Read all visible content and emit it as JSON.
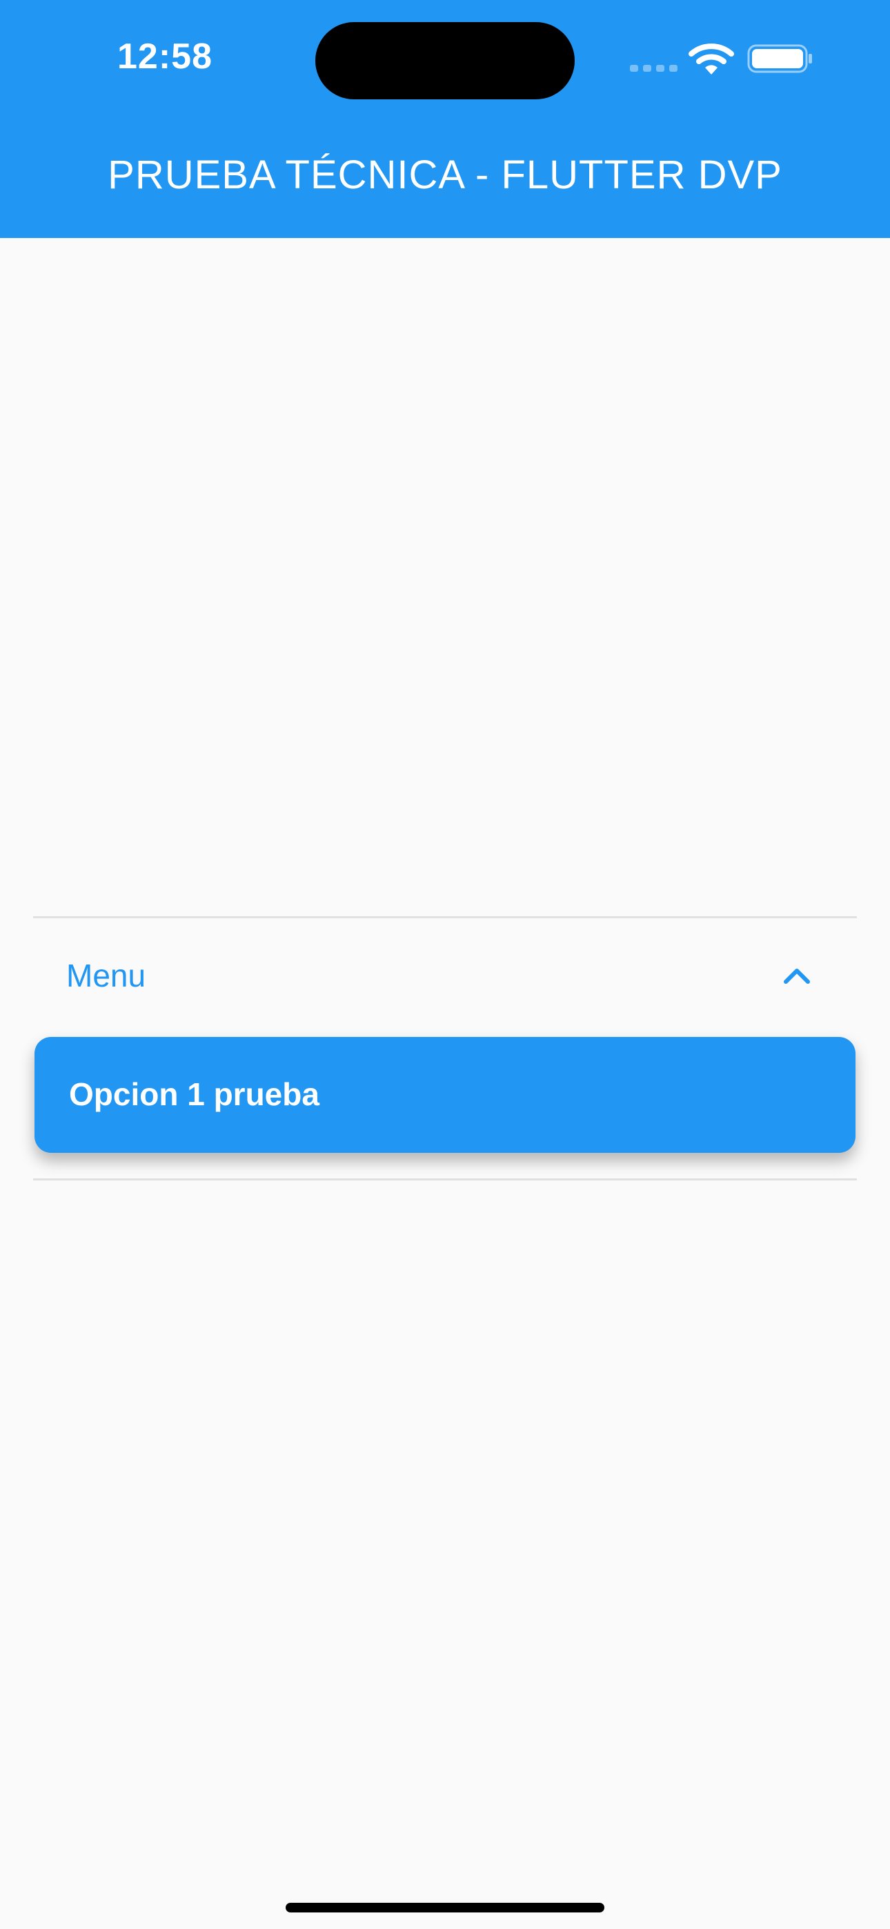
{
  "status_bar": {
    "time": "12:58"
  },
  "app_bar": {
    "title": "PRUEBA TÉCNICA - FLUTTER DVP",
    "color": "#2196f3"
  },
  "menu_panel": {
    "label": "Menu",
    "expanded": true,
    "toggle_icon": "chevron-up-icon",
    "options": [
      {
        "label": "Opcion 1 prueba"
      }
    ]
  },
  "colors": {
    "accent": "#2196f3",
    "background": "#fafafa",
    "divider": "#e0e0e0"
  }
}
